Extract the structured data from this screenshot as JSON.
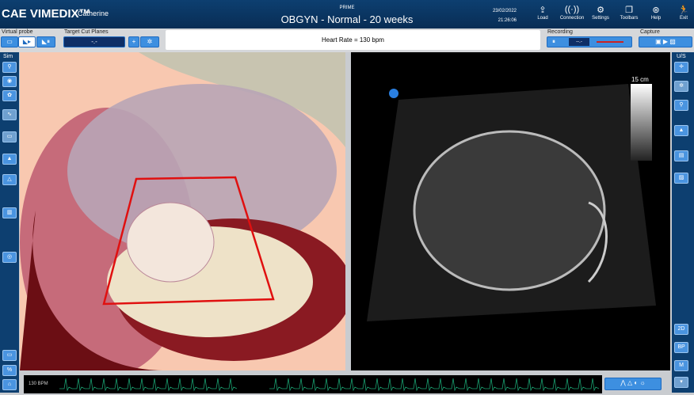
{
  "header": {
    "brand": "CAE VIMEDIX™",
    "user": "Catherine",
    "product": "PRIME",
    "mode": "OBGYN - Normal - 20 weeks",
    "date": "23/02/2022",
    "time": "21:26:06",
    "tools": [
      {
        "label": "Load",
        "icon": "load-icon"
      },
      {
        "label": "Connection",
        "icon": "connection-icon"
      },
      {
        "label": "Settings",
        "icon": "gear-icon"
      },
      {
        "label": "Toolbars",
        "icon": "toolbars-icon"
      },
      {
        "label": "Help",
        "icon": "help-icon"
      },
      {
        "label": "Exit",
        "icon": "exit-icon"
      }
    ]
  },
  "toolbar": {
    "virtual_probe": "Virtual probe",
    "target_cut_planes": "Target Cut Planes",
    "cut_value": "-.-",
    "heart_rate": "Heart Rate = 130 bpm",
    "recording": "Recording",
    "rec_value": "--.-",
    "capture": "Capture"
  },
  "left_sidebar": {
    "title": "Sim"
  },
  "right_sidebar": {
    "title": "U/S",
    "buttons": [
      "2D",
      "BP",
      "M"
    ]
  },
  "ultrasound": {
    "depth": "15 cm"
  },
  "ecg": {
    "label": "130 BPM",
    "color": "#1aa070"
  },
  "colors": {
    "header": "#0d3f70",
    "button": "#3d8fe0",
    "sector": "#e01010"
  }
}
